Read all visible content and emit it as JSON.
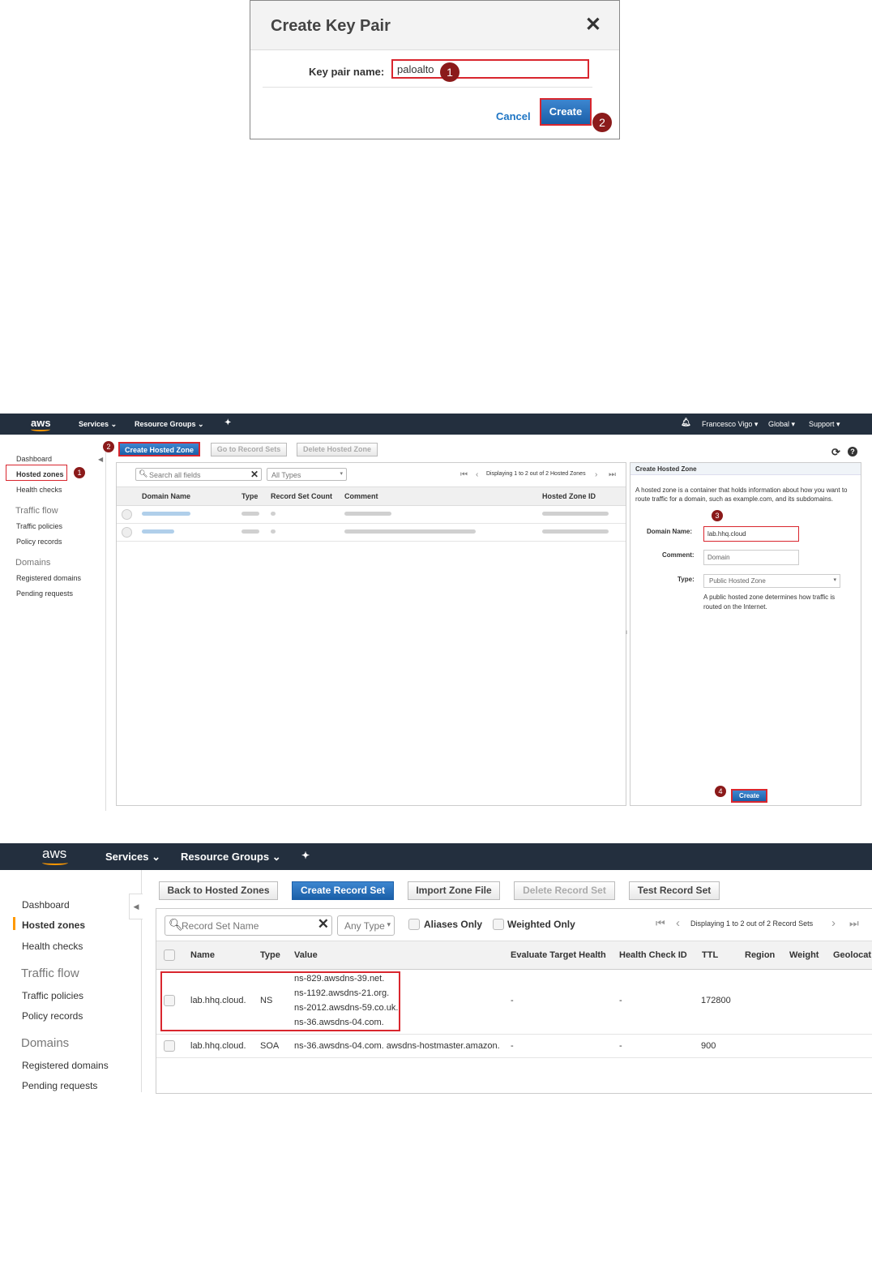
{
  "keypair_dialog": {
    "title": "Create Key Pair",
    "close_glyph": "✕",
    "field_label": "Key pair name:",
    "field_value": "paloalto",
    "cancel_label": "Cancel",
    "create_label": "Create",
    "step_1": "1",
    "step_2": "2"
  },
  "route53_zones": {
    "nav": {
      "logo": "aws",
      "services": "Services",
      "resource_groups": "Resource Groups",
      "user": "Francesco Vigo",
      "region": "Global",
      "support": "Support"
    },
    "sidebar": {
      "dashboard": "Dashboard",
      "hosted_zones": "Hosted zones",
      "health_checks": "Health checks",
      "traffic_flow": "Traffic flow",
      "traffic_policies": "Traffic policies",
      "policy_records": "Policy records",
      "domains": "Domains",
      "registered_domains": "Registered domains",
      "pending_requests": "Pending requests"
    },
    "toolbar": {
      "create_hosted_zone": "Create Hosted Zone",
      "go_to_record_sets": "Go to Record Sets",
      "delete_hosted_zone": "Delete Hosted Zone"
    },
    "filter": {
      "search_placeholder": "Search all fields",
      "type_select": "All Types",
      "pagination": "Displaying 1 to 2 out of 2 Hosted Zones"
    },
    "columns": [
      "Domain Name",
      "Type",
      "Record Set Count",
      "Comment",
      "Hosted Zone ID"
    ],
    "panel": {
      "title": "Create Hosted Zone",
      "description": "A hosted zone is a container that holds information about how you want to route traffic for a domain, such as example.com, and its subdomains.",
      "domain_name_label": "Domain Name:",
      "domain_name_value": "lab.hhq.cloud",
      "comment_label": "Comment:",
      "comment_value": "Domain",
      "type_label": "Type:",
      "type_value": "Public Hosted Zone",
      "type_help": "A public hosted zone determines how traffic is routed on the Internet.",
      "create_label": "Create"
    },
    "steps": [
      "1",
      "2",
      "3",
      "4"
    ]
  },
  "route53_records": {
    "nav": {
      "logo": "aws",
      "services": "Services",
      "resource_groups": "Resource Groups"
    },
    "sidebar": {
      "dashboard": "Dashboard",
      "hosted_zones": "Hosted zones",
      "health_checks": "Health checks",
      "traffic_flow": "Traffic flow",
      "traffic_policies": "Traffic policies",
      "policy_records": "Policy records",
      "domains": "Domains",
      "registered_domains": "Registered domains",
      "pending_requests": "Pending requests"
    },
    "toolbar": {
      "back": "Back to Hosted Zones",
      "create_record_set": "Create Record Set",
      "import_zone_file": "Import Zone File",
      "delete_record_set": "Delete Record Set",
      "test_record_set": "Test Record Set"
    },
    "filter": {
      "search_placeholder": "Record Set Name",
      "type_select": "Any Type",
      "aliases_only": "Aliases Only",
      "weighted_only": "Weighted Only",
      "pagination": "Displaying 1 to 2 out of 2 Record Sets"
    },
    "columns": {
      "name": "Name",
      "type": "Type",
      "value": "Value",
      "eval": "Evaluate Target Health",
      "hcid": "Health Check ID",
      "ttl": "TTL",
      "region": "Region",
      "weight": "Weight",
      "geo": "Geolocat"
    },
    "rows": [
      {
        "name": "lab.hhq.cloud.",
        "type": "NS",
        "values": [
          "ns-829.awsdns-39.net.",
          "ns-1192.awsdns-21.org.",
          "ns-2012.awsdns-59.co.uk.",
          "ns-36.awsdns-04.com."
        ],
        "eval": "-",
        "hcid": "-",
        "ttl": "172800"
      },
      {
        "name": "lab.hhq.cloud.",
        "type": "SOA",
        "values": [
          "ns-36.awsdns-04.com. awsdns-hostmaster.amazon."
        ],
        "eval": "-",
        "hcid": "-",
        "ttl": "900"
      }
    ]
  },
  "colors": {
    "nav_bg": "#232f3e",
    "accent_orange": "#ff9900",
    "primary_blue": "#1a5fa8",
    "highlight_red": "#d9262e",
    "step_badge": "#8b1a1a"
  }
}
